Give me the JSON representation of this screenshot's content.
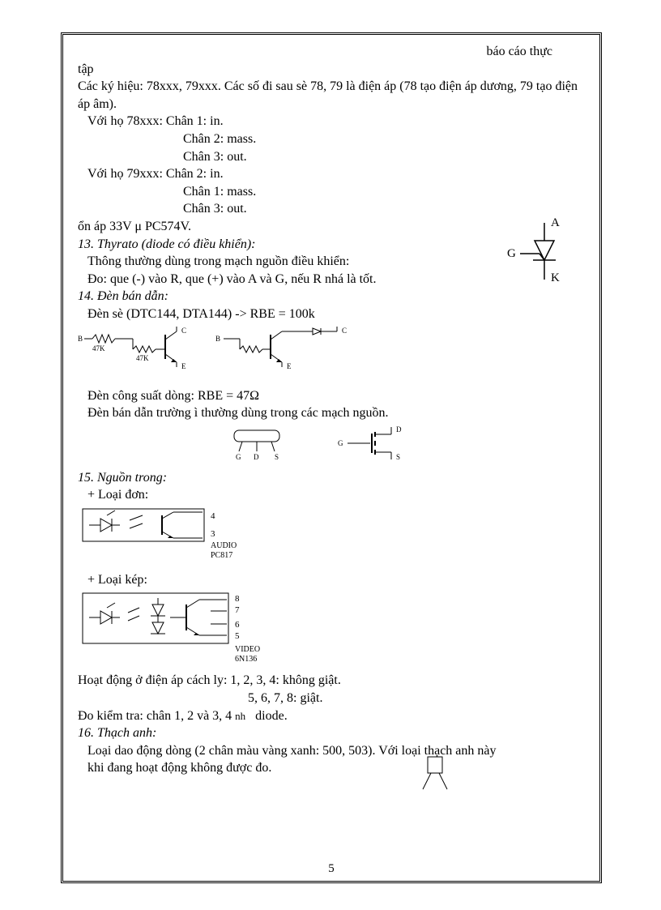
{
  "header": {
    "title": "báo cáo thực"
  },
  "line_tap": "tập",
  "p1": "Các ký hiệu: 78xxx, 79xxx. Các số đi sau sè 78, 79 là điện áp (78 tạo điện áp dương, 79 tạo điện áp âm).",
  "fam78_header": "Với họ 78xxx: Chân 1: in.",
  "fam78_2": "Chân 2: mass.",
  "fam78_3": "Chân 3: out.",
  "fam79_header": "Với họ 79xxx: Chân 2: in.",
  "fam79_1": "Chân 1: mass.",
  "fam79_3": "Chân 3: out.",
  "stab_line": "ổn áp 33V μ PC574V.",
  "sec13_title": "13. Thyrato (diode có điều khiển):",
  "sec13_l1": "Thông thường dùng trong mạch nguồn điều khiển:",
  "sec13_l2": "Đo: que (-) vào R, que (+) vào A và G, nếu R nhá là tốt.",
  "thyristor": {
    "A": "A",
    "G": "G",
    "K": "K"
  },
  "sec14_title": "14. Đèn bán dẫn:",
  "sec14_l1": "Đèn sè (DTC144, DTA144) -> RBE = 100k",
  "circ1": {
    "B1": "B",
    "R1": "47K",
    "R2": "47K",
    "C1": "C",
    "E1": "E",
    "B2": "B",
    "C2": "C",
    "E2": "E"
  },
  "sec14_l2": "Đèn công suất dòng: RBE = 47Ω",
  "sec14_l3": "Đèn bán dẫn trường ì thường dùng trong các mạch nguồn.",
  "fet": {
    "G": "G",
    "D": "D",
    "S": "S",
    "G2": "G",
    "D2": "D",
    "S2": "S"
  },
  "sec15_title": "15. Nguồn trong:",
  "sec15_single": "+ Loại đơn:",
  "opto1": {
    "p4": "4",
    "p3": "3",
    "name1": "AUDIO",
    "name2": "PC817"
  },
  "sec15_double": "+ Loại kép:",
  "opto2": {
    "p8": "8",
    "p7": "7",
    "p6": "6",
    "p5": "5",
    "name1": "VIDEO",
    "name2": "6N136"
  },
  "sec15_l1": "Hoạt động ở điện áp cách ly: 1, 2, 3, 4: không giật.",
  "sec15_l2": "5, 6, 7, 8: giật.",
  "sec15_l3a": "Đo kiểm tra: chân 1, 2 và 3, 4",
  "sec15_l3b": "nh",
  "sec15_l3c": "diode.",
  "sec16_title": "16. Thạch anh:",
  "sec16_l1": "Loại dao động dòng (2 chân màu vàng xanh: 500, 503). Với loại thạch anh này khi đang hoạt động không được đo.",
  "page_number": "5"
}
